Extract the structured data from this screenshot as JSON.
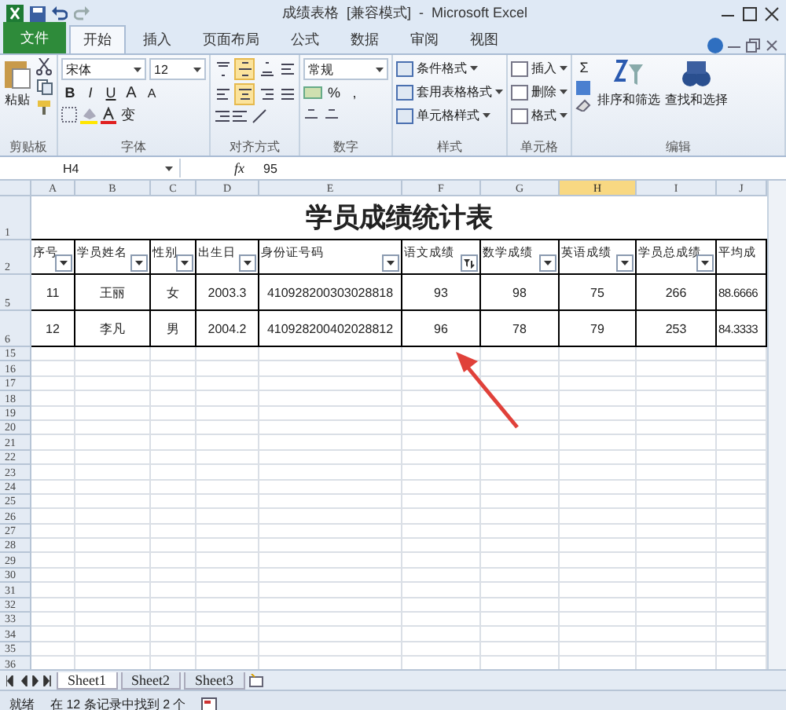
{
  "window": {
    "title": "成绩表格  [兼容模式]  -  Microsoft Excel"
  },
  "tabs": [
    {
      "label": "文件",
      "kind": "file",
      "selected": false
    },
    {
      "label": "开始",
      "kind": "tab",
      "selected": true
    },
    {
      "label": "插入",
      "kind": "tab",
      "selected": false
    },
    {
      "label": "页面布局",
      "kind": "tab",
      "selected": false
    },
    {
      "label": "公式",
      "kind": "tab",
      "selected": false
    },
    {
      "label": "数据",
      "kind": "tab",
      "selected": false
    },
    {
      "label": "审阅",
      "kind": "tab",
      "selected": false
    },
    {
      "label": "视图",
      "kind": "tab",
      "selected": false
    }
  ],
  "ribbon": [
    {
      "kind": "clipboard",
      "label": "剪贴板",
      "paste": "粘贴"
    },
    {
      "kind": "font",
      "label": "字体",
      "font_name": "宋体",
      "font_size": "12",
      "bold": "B",
      "italic": "I",
      "underline": "U",
      "grow": "A",
      "shrink": "A",
      "phonetic": "变"
    },
    {
      "kind": "align",
      "label": "对齐方式",
      "buttons": [
        {
          "kind": "top",
          "selected": false
        },
        {
          "kind": "middle",
          "selected": true
        },
        {
          "kind": "bottom",
          "selected": false
        },
        {
          "kind": "wrap",
          "selected": false
        },
        {
          "kind": "left",
          "selected": false
        },
        {
          "kind": "center",
          "selected": true
        },
        {
          "kind": "right",
          "selected": false
        },
        {
          "kind": "merge",
          "selected": false
        }
      ]
    },
    {
      "kind": "number",
      "label": "数字",
      "format": "常规",
      "percent": "%",
      "comma": ","
    },
    {
      "kind": "styles",
      "label": "样式",
      "items": [
        "条件格式",
        "套用表格格式",
        "单元格样式"
      ]
    },
    {
      "kind": "cells",
      "label": "单元格",
      "items": [
        "插入",
        "删除",
        "格式"
      ]
    },
    {
      "kind": "editing",
      "label": "编辑",
      "sigma": "Σ",
      "items": [
        "排序和筛选",
        "查找和选择"
      ]
    }
  ],
  "formula_bar": {
    "name_box": "H4",
    "fx": "fx",
    "value": "95"
  },
  "columns": [
    {
      "label": "A",
      "selected": false
    },
    {
      "label": "B",
      "selected": false
    },
    {
      "label": "C",
      "selected": false
    },
    {
      "label": "D",
      "selected": false
    },
    {
      "label": "E",
      "selected": false
    },
    {
      "label": "F",
      "selected": false
    },
    {
      "label": "G",
      "selected": false
    },
    {
      "label": "H",
      "selected": true
    },
    {
      "label": "I",
      "selected": false
    },
    {
      "label": "J",
      "selected": false
    }
  ],
  "rows": [
    {
      "number": "1",
      "kind": "title",
      "text": "学员成绩统计表"
    },
    {
      "number": "2",
      "kind": "header",
      "cells": [
        {
          "text": "序号",
          "filtered": false
        },
        {
          "text": "学员姓名",
          "filtered": false
        },
        {
          "text": "性别",
          "filtered": false
        },
        {
          "text": "出生日",
          "filtered": false
        },
        {
          "text": "身份证号码",
          "filtered": false
        },
        {
          "text": "语文成绩",
          "filtered": true
        },
        {
          "text": "数学成绩",
          "filtered": false
        },
        {
          "text": "英语成绩",
          "filtered": false
        },
        {
          "text": "学员总成绩",
          "filtered": false
        },
        {
          "text": "平均成",
          "kind": "plain"
        }
      ]
    },
    {
      "number": "5",
      "kind": "data",
      "cells": [
        "11",
        "王丽",
        "女",
        "2003.3",
        "410928200303028818",
        "93",
        "98",
        "75",
        "266",
        "88.6666"
      ]
    },
    {
      "number": "6",
      "kind": "data",
      "cells": [
        "12",
        "李凡",
        "男",
        "2004.2",
        "410928200402028812",
        "96",
        "78",
        "79",
        "253",
        "84.3333"
      ]
    },
    {
      "number": "15",
      "kind": "empty"
    },
    {
      "number": "16",
      "kind": "empty"
    },
    {
      "number": "17",
      "kind": "empty"
    },
    {
      "number": "18",
      "kind": "empty"
    },
    {
      "number": "19",
      "kind": "empty"
    },
    {
      "number": "20",
      "kind": "empty"
    },
    {
      "number": "21",
      "kind": "empty"
    },
    {
      "number": "22",
      "kind": "empty"
    },
    {
      "number": "23",
      "kind": "empty"
    },
    {
      "number": "24",
      "kind": "empty"
    },
    {
      "number": "25",
      "kind": "empty"
    },
    {
      "number": "26",
      "kind": "empty"
    },
    {
      "number": "27",
      "kind": "empty"
    },
    {
      "number": "28",
      "kind": "empty"
    },
    {
      "number": "29",
      "kind": "empty"
    },
    {
      "number": "30",
      "kind": "empty"
    },
    {
      "number": "31",
      "kind": "empty"
    },
    {
      "number": "32",
      "kind": "empty"
    },
    {
      "number": "33",
      "kind": "empty"
    },
    {
      "number": "34",
      "kind": "empty"
    },
    {
      "number": "35",
      "kind": "empty"
    },
    {
      "number": "36",
      "kind": "empty"
    }
  ],
  "sheets": [
    {
      "label": "Sheet1",
      "selected": true
    },
    {
      "label": "Sheet2",
      "selected": false
    },
    {
      "label": "Sheet3",
      "selected": false
    }
  ],
  "status_bar": {
    "state": "就绪",
    "message": "在 12 条记录中找到 2 个"
  }
}
